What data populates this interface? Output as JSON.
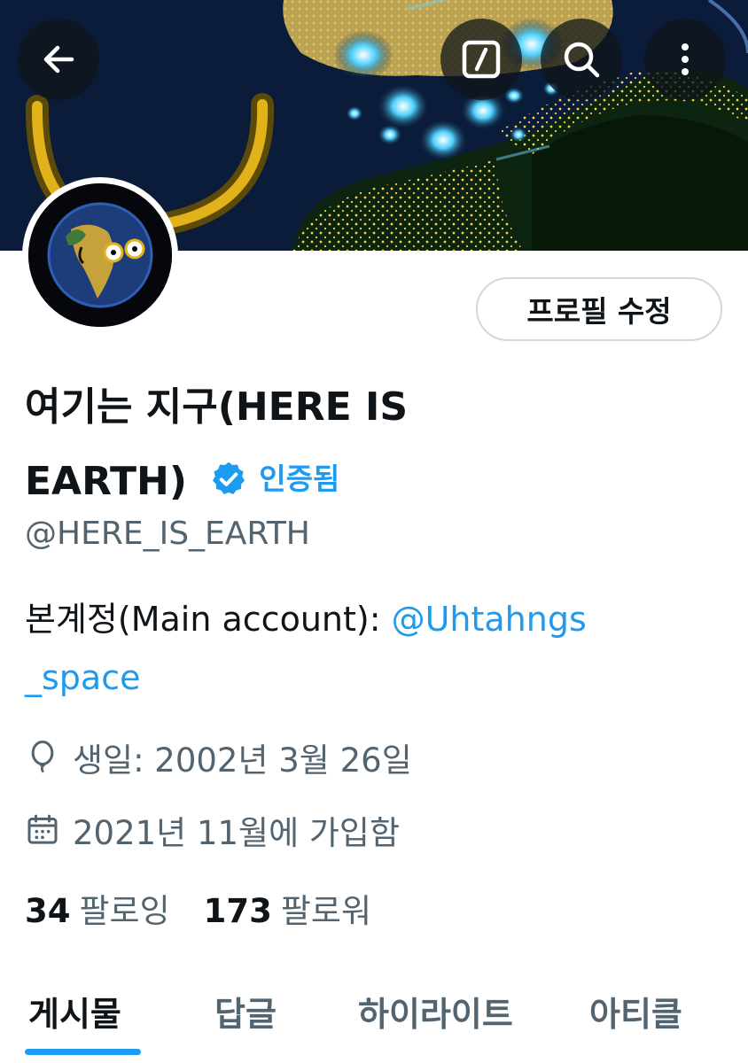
{
  "header": {
    "back_icon": "arrow-left-icon",
    "edit_icon": "slash-square-icon",
    "search_icon": "search-icon",
    "more_icon": "more-vertical-icon"
  },
  "profile": {
    "edit_button_label": "프로필 수정",
    "name_line1": "여기는 지구(HERE IS",
    "name_line2": "EARTH)",
    "verified_label": "인증됨",
    "handle": "@HERE_IS_EARTH",
    "bio_prefix": "본계정(Main account): ",
    "bio_link_part1": "@Uhtahngs",
    "bio_link_part2": "_space",
    "birthday": "생일: 2002년 3월 26일",
    "joined": "2021년 11월에 가입함",
    "following_count": "34",
    "following_label": "팔로잉",
    "followers_count": "173",
    "followers_label": "팔로워"
  },
  "tabs": [
    {
      "label": "게시물",
      "active": true
    },
    {
      "label": "답글",
      "active": false
    },
    {
      "label": "하이라이트",
      "active": false
    },
    {
      "label": "아티클",
      "active": false
    }
  ],
  "colors": {
    "accent": "#1d9bf0",
    "text_primary": "#0f1419",
    "text_secondary": "#536471",
    "border": "#cfd9de"
  }
}
